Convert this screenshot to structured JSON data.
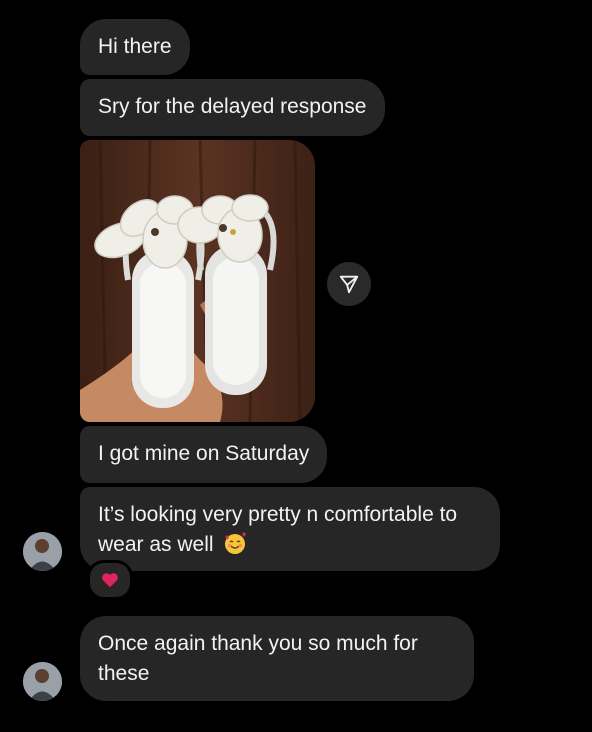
{
  "messages": {
    "m1": "Hi there",
    "m2": "Sry for the delayed response",
    "m3": "I got mine on Saturday",
    "m4": "It’s looking very pretty n comfortable to wear as well",
    "m5": "Once again thank you so much for these"
  },
  "icons": {
    "share": "send-paper-plane-icon",
    "reaction": "red-heart-icon",
    "emoji": "smiling-face-with-hearts-icon"
  },
  "colors": {
    "background": "#000000",
    "bubble": "#262626",
    "text": "#f2f2f2",
    "heart": "#e0245e"
  }
}
